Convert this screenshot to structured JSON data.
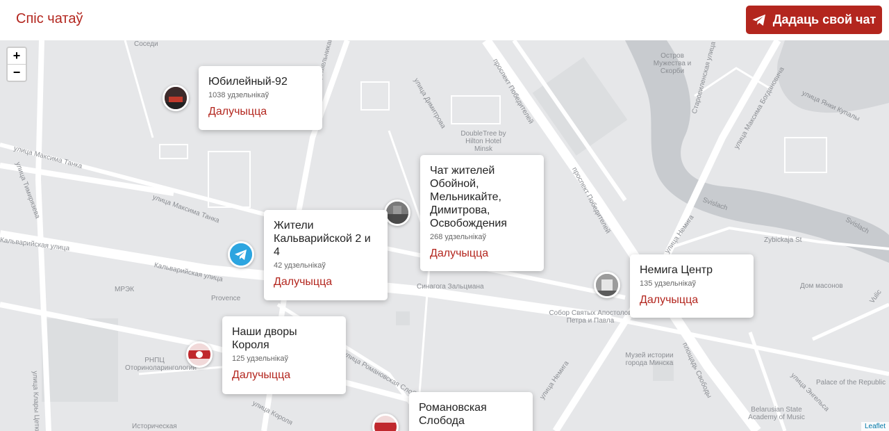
{
  "header": {
    "chat_list_label": "Спіс чатаў",
    "add_chat_label": "Дадаць свой чат"
  },
  "map": {
    "zoom_in": "+",
    "zoom_out": "−",
    "attribution": "Leaflet",
    "labels": {
      "soseди": "Соседи",
      "melnikaite1": "улица Мельникайте",
      "dimitrova": "улица Димитрова",
      "pobediteley1": "проспект Победителей",
      "ostrov": "Остров Мужества и Скорби",
      "starovilenskaya": "Старовиленская улица",
      "bogdanovicha": "улица Максима Богдановича",
      "kupaly": "улица Янки Купалы",
      "doubletree": "DoubleTree by Hilton Hotel Minsk",
      "tanka1": "улица Максима Танка",
      "timiryazeva": "улица Тимирязева",
      "tanka2": "улица Максима Танка",
      "pobediteley2": "проспект Победителей",
      "svislach1": "Svislach",
      "svislach2": "Svislach",
      "nemiga1": "улица Немига",
      "zybickaja": "Zybickaja St",
      "kalvariyskaya1": "Кальварийская улица",
      "kalvariyskaya2": "Кальварийская улица",
      "mrek": "МРЭК",
      "provence": "Provence",
      "sinagoga": "Синагога Зальцмана",
      "sobor": "Собор Святых Апостолов Петра и Павла",
      "domasonov": "Дом масонов",
      "rnpc": "РНПЦ Оториноларингологии",
      "romanovskaya": "улица Романовская Слобода",
      "muzey": "Музей истории города Минска",
      "svobody": "площадь Свободы",
      "nemiga2": "улица Немига",
      "engelsa": "улица Энгельса",
      "palace": "Palace of the Republic",
      "academy": "Belarusian State Academy of Music",
      "zetkin": "улица Клары Цеткин",
      "korolya": "улица Короля",
      "istoricheskaya": "Историческая",
      "vulic": "Vulic"
    }
  },
  "chats": [
    {
      "title": "Юбилейный-92",
      "count": "1038 удзельнікаў",
      "join": "Далучыцца",
      "avatar": "photo-avatar-red"
    },
    {
      "title": "Чат жителей Обойной, Мельникайте, Димитрова, Освобождения",
      "count": "268 удзельнікаў",
      "join": "Далучыцца",
      "avatar": "photo-avatar-street"
    },
    {
      "title": "Жители Кальварийской 2 и 4",
      "count": "42 удзельнікаў",
      "join": "Далучыцца",
      "avatar": "telegram-icon"
    },
    {
      "title": "Немига Центр",
      "count": "135 удзельнікаў",
      "join": "Далучыцца",
      "avatar": "photo-avatar-building"
    },
    {
      "title": "Наши дворы Короля",
      "count": "125 удзельнікаў",
      "join": "Далучыцца",
      "avatar": "photo-avatar-flag"
    },
    {
      "title": "Романовская Слобода",
      "count": "",
      "join": "",
      "avatar": "photo-avatar-flag"
    }
  ],
  "colors": {
    "accent": "#b3261e",
    "map_bg": "#e6e7e9",
    "water": "#c8cbcf",
    "telegram": "#2ca5e0"
  }
}
